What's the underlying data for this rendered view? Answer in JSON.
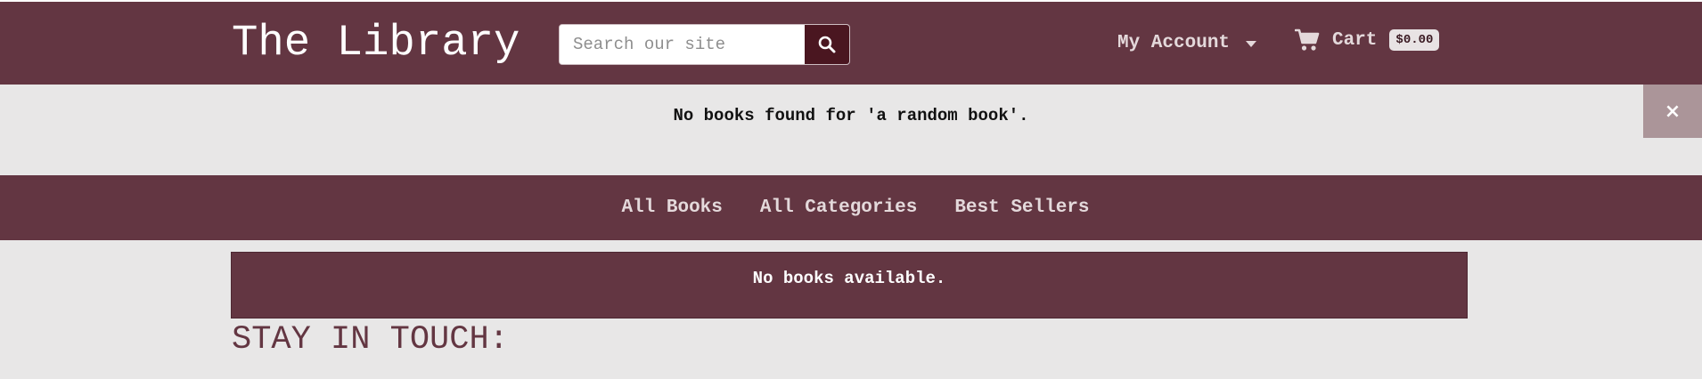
{
  "header": {
    "logo": "The Library",
    "search": {
      "placeholder": "Search our site",
      "value": ""
    },
    "account_label": "My Account",
    "cart": {
      "label": "Cart",
      "total": "$0.00"
    }
  },
  "flash": {
    "message": "No books found for 'a random book'.",
    "close_glyph": "×"
  },
  "nav": {
    "items": [
      {
        "label": "All Books"
      },
      {
        "label": "All Categories"
      },
      {
        "label": "Best Sellers"
      }
    ]
  },
  "main": {
    "empty_message": "No books available."
  },
  "footer": {
    "heading": "STAY IN TOUCH:"
  },
  "colors": {
    "brand": "#633642",
    "brand_dark": "#4a1620",
    "background": "#e8e7e7",
    "close_button": "#ab9599",
    "nav_text": "#e4d9db"
  },
  "icons": {
    "search": "search-icon",
    "caret": "caret-down-icon",
    "cart": "shopping-cart-icon",
    "close": "close-icon"
  }
}
